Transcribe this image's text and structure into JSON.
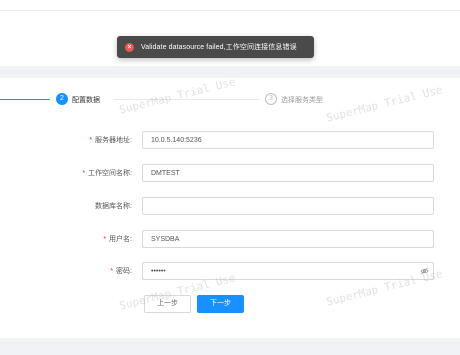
{
  "toast": {
    "message": "Validate datasource failed,工作空间连接信息错误"
  },
  "steps": {
    "current": {
      "number": "2",
      "label": "配置数据"
    },
    "next": {
      "number": "3",
      "label": "选择服务类型"
    }
  },
  "form": {
    "server_address": {
      "label": "服务器地址:",
      "value": "10.0.5.140:5236",
      "required": true
    },
    "workspace_name": {
      "label": "工作空间名称:",
      "value": "DMTEST",
      "required": true
    },
    "database_name": {
      "label": "数据库名称:",
      "value": "",
      "required": false
    },
    "username": {
      "label": "用户名:",
      "value": "SYSDBA",
      "required": true
    },
    "password": {
      "label": "密码:",
      "value": "••••••",
      "required": true
    }
  },
  "buttons": {
    "prev": "上一步",
    "next": "下一步"
  },
  "watermark": "SuperMap Trial Use",
  "colors": {
    "primary": "#1890ff",
    "error": "#e8594f",
    "required": "#f5222d",
    "toast_bg": "#4a4a4a",
    "band": "#f0f2f5"
  }
}
